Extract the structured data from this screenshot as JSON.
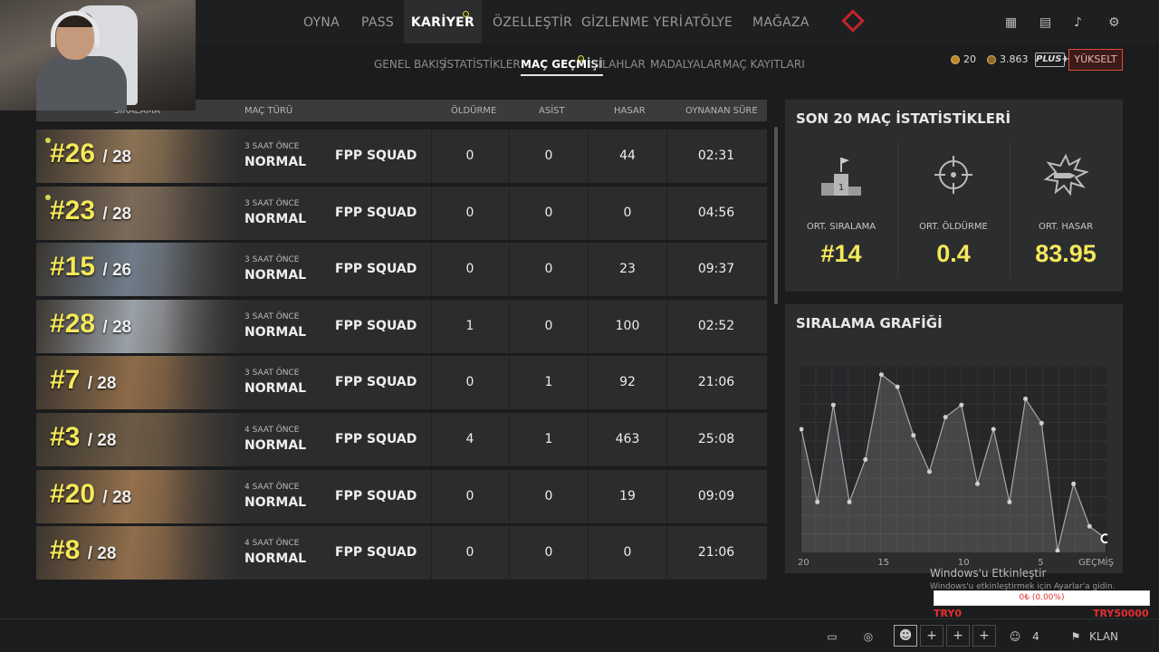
{
  "nav": {
    "items": [
      "OYNA",
      "PASS",
      "KARİYER",
      "ÖZELLEŞTİR",
      "GİZLENME YERİ",
      "ATÖLYE",
      "MAĞAZA"
    ],
    "active": "KARİYER"
  },
  "subnav": {
    "items": [
      "GENEL BAKIŞ",
      "İSTATİSTİKLER",
      "MAÇ GEÇMİŞİ",
      "SİLAHLAR",
      "MADALYALAR",
      "MAÇ KAYITLARI"
    ],
    "active": "MAÇ GEÇMİŞİ"
  },
  "currency": {
    "coins": "20",
    "bp": "3.863",
    "plus": "PLUS+",
    "upgrade": "YÜKSELT"
  },
  "table": {
    "headers": {
      "rank": "SIRALAMA",
      "mode": "MAÇ TÜRÜ",
      "kills": "ÖLDÜRME",
      "assists": "ASİST",
      "damage": "HASAR",
      "time": "OYNANAN SÜRE"
    },
    "rows": [
      {
        "rank": "#26",
        "total": "/ 28",
        "ago": "3 SAAT ÖNCE",
        "mode": "NORMAL",
        "squad": "FPP SQUAD",
        "kills": "0",
        "assists": "0",
        "damage": "44",
        "time": "02:31",
        "map": "#8a7154"
      },
      {
        "rank": "#23",
        "total": "/ 28",
        "ago": "3 SAAT ÖNCE",
        "mode": "NORMAL",
        "squad": "FPP SQUAD",
        "kills": "0",
        "assists": "0",
        "damage": "0",
        "time": "04:56",
        "map": "#7a6a58"
      },
      {
        "rank": "#15",
        "total": "/ 26",
        "ago": "3 SAAT ÖNCE",
        "mode": "NORMAL",
        "squad": "FPP SQUAD",
        "kills": "0",
        "assists": "0",
        "damage": "23",
        "time": "09:37",
        "map": "#6f7c8a"
      },
      {
        "rank": "#28",
        "total": "/ 28",
        "ago": "3 SAAT ÖNCE",
        "mode": "NORMAL",
        "squad": "FPP SQUAD",
        "kills": "1",
        "assists": "0",
        "damage": "100",
        "time": "02:52",
        "map": "#9aa0a8"
      },
      {
        "rank": "#7",
        "total": "/ 28",
        "ago": "3 SAAT ÖNCE",
        "mode": "NORMAL",
        "squad": "FPP SQUAD",
        "kills": "0",
        "assists": "1",
        "damage": "92",
        "time": "21:06",
        "map": "#8c6a48"
      },
      {
        "rank": "#3",
        "total": "/ 28",
        "ago": "4 SAAT ÖNCE",
        "mode": "NORMAL",
        "squad": "FPP SQUAD",
        "kills": "4",
        "assists": "1",
        "damage": "463",
        "time": "25:08",
        "map": "#6b5a44"
      },
      {
        "rank": "#20",
        "total": "/ 28",
        "ago": "4 SAAT ÖNCE",
        "mode": "NORMAL",
        "squad": "FPP SQUAD",
        "kills": "0",
        "assists": "0",
        "damage": "19",
        "time": "09:09",
        "map": "#94704c"
      },
      {
        "rank": "#8",
        "total": "/ 28",
        "ago": "4 SAAT ÖNCE",
        "mode": "NORMAL",
        "squad": "FPP SQUAD",
        "kills": "0",
        "assists": "0",
        "damage": "0",
        "time": "21:06",
        "map": "#8e6c4a"
      }
    ]
  },
  "stats": {
    "title": "SON 20 MAÇ İSTATİSTİKLERİ",
    "items": [
      {
        "label": "ORT. SIRALAMA",
        "value": "#14",
        "icon": "podium-icon"
      },
      {
        "label": "ORT. ÖLDÜRME",
        "value": "0.4",
        "icon": "crosshair-icon"
      },
      {
        "label": "ORT. HASAR",
        "value": "83.95",
        "icon": "bullet-impact-icon"
      }
    ]
  },
  "chart_title": "SIRALAMA GRAFİĞİ",
  "chart_data": {
    "type": "line",
    "title": "SIRALAMA GRAFİĞİ",
    "x_tick_labels": [
      "20",
      "15",
      "10",
      "5",
      "GEÇMİŞ"
    ],
    "x": [
      20,
      19,
      18,
      17,
      16,
      15,
      14,
      13,
      12,
      11,
      10,
      9,
      8,
      7,
      6,
      5,
      4,
      3,
      2,
      1
    ],
    "values": [
      10,
      22,
      6,
      22,
      15,
      1,
      3,
      11,
      17,
      8,
      6,
      19,
      10,
      22,
      5,
      9,
      30,
      19,
      26,
      28
    ],
    "ylim": [
      0,
      30
    ],
    "y_inverted": true,
    "grid": true
  },
  "bottombar": {
    "party_count": "4",
    "clan": "KLAN"
  },
  "windows": {
    "line1": "Windows'u Etkinleştir",
    "line2": "Windows'u etkinleştirmek için Ayarlar'a gidin."
  },
  "donation": {
    "bar": "0₺ (0.00%)",
    "left": "TRY0",
    "right": "TRY50000"
  }
}
